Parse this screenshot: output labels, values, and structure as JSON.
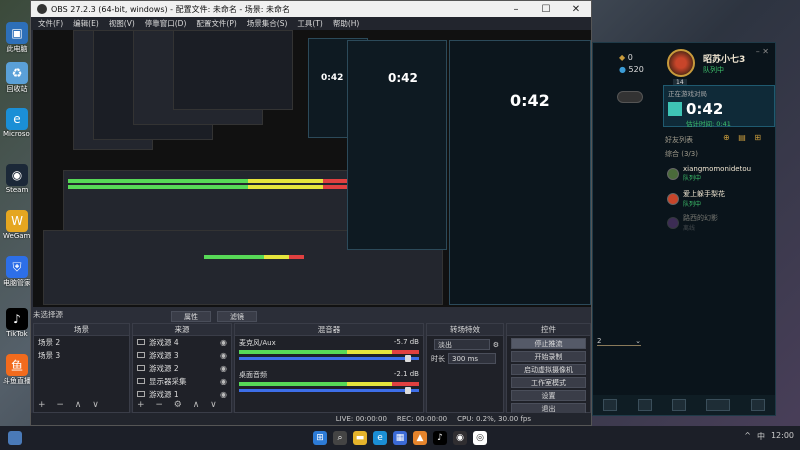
{
  "desktop": {
    "icons": [
      "此电脑",
      "回收站",
      "Microsoft Edge",
      "Steam",
      "WeGame",
      "电脑管家",
      "TikTok",
      "斗鱼直播"
    ]
  },
  "obs": {
    "title": "OBS 27.2.3 (64-bit, windows) - 配置文件: 未命名 - 场景: 未命名",
    "menu": [
      "文件(F)",
      "编辑(E)",
      "视图(V)",
      "停靠窗口(D)",
      "配置文件(P)",
      "场景集合(S)",
      "工具(T)",
      "帮助(H)"
    ],
    "scene_filter_label": "未选择源",
    "scenes": {
      "header": "场景",
      "items": [
        "场景 2",
        "场景 3"
      ]
    },
    "sources": {
      "header": "来源",
      "items": [
        "游戏源 4",
        "游戏源 3",
        "游戏源 2",
        "显示器采集",
        "游戏源 1"
      ]
    },
    "props_button": "属性",
    "filters_button": "滤镜",
    "mixer": {
      "header": "混音器",
      "channels": [
        {
          "name": "麦克风/Aux",
          "db": "-5.7 dB"
        },
        {
          "name": "桌面音频",
          "db": "-2.1 dB"
        }
      ]
    },
    "transitions": {
      "header": "转场特效",
      "type": "淡出",
      "duration_label": "时长",
      "duration": "300 ms"
    },
    "controls": {
      "header": "控件",
      "buttons": [
        "停止推流",
        "开始录制",
        "启动虚拟摄像机",
        "工作室模式",
        "设置",
        "退出"
      ]
    },
    "status": {
      "live": "LIVE: 00:00:00",
      "rec": "REC: 00:00:00",
      "cpu": "CPU: 0.2%, 30.00 fps"
    }
  },
  "lol_main": {
    "currency_1": "0",
    "currency_2": "520",
    "name": "昭苏小七3",
    "status": "队列中",
    "level": "14",
    "ingame_label": "正在游戏对局",
    "timer": "0:42",
    "timer_sub_label": "估计时间:",
    "timer_sub": "0:41",
    "friends_header": "好友列表",
    "group": "综合 (3/3)",
    "friends": [
      {
        "name": "xiangmomonidetou",
        "status": "队列中"
      },
      {
        "name": "爱上躲手梨花",
        "status": "队列中"
      },
      {
        "name": "路西的幻影",
        "status": "离线"
      }
    ],
    "dropdown_value": "2"
  },
  "taskbar": {
    "apps": [
      "Windows",
      "Search",
      "File Explorer",
      "Edge",
      "Store",
      "Photos",
      "TikTok",
      "OBS",
      "Chrome"
    ],
    "tray": [
      "^",
      "中",
      "12:00"
    ]
  }
}
